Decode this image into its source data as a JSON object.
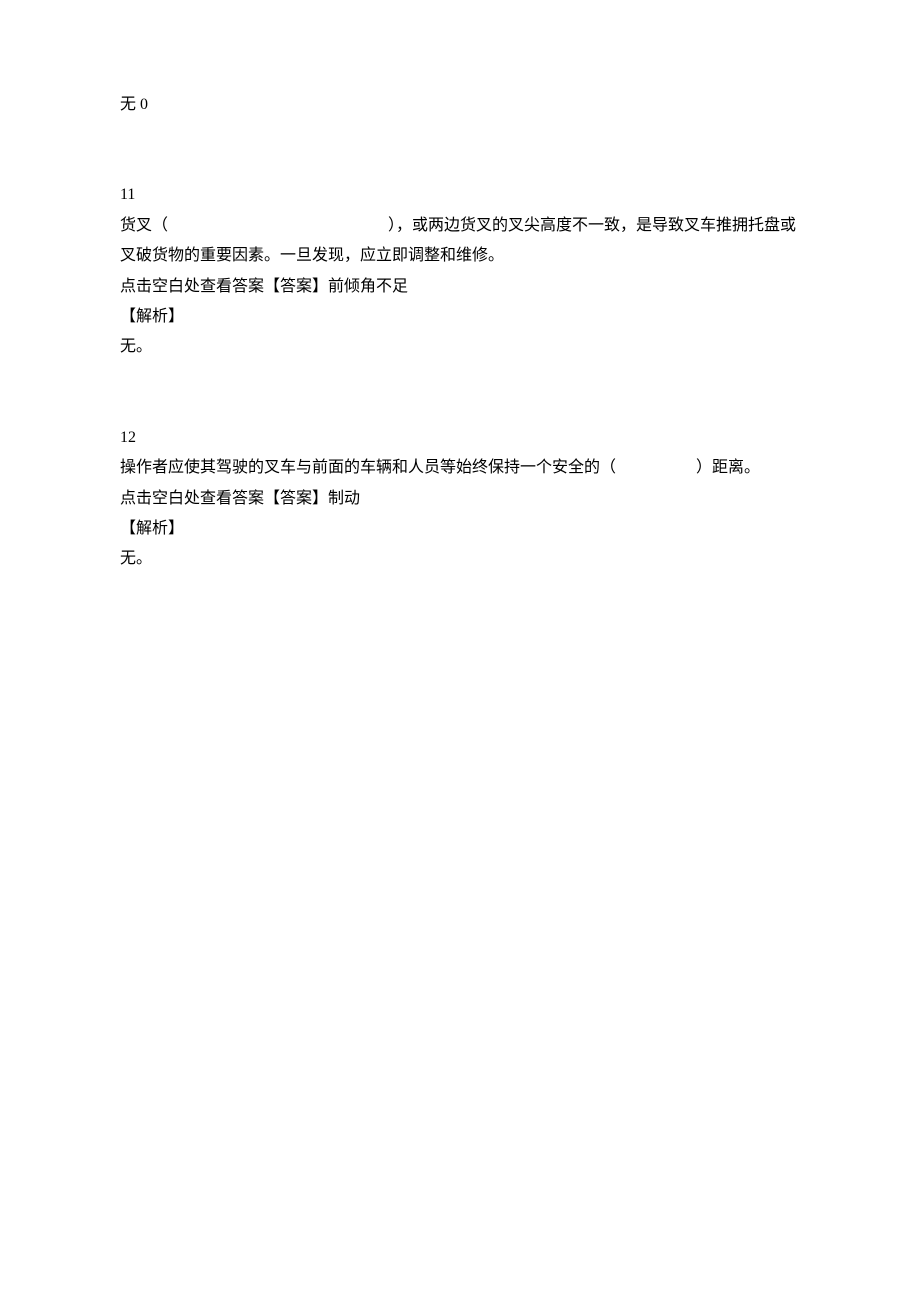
{
  "top_fragment": "无 0",
  "questions": [
    {
      "number": "11",
      "text_before": "货叉（",
      "text_after": "），或两边货叉的叉尖高度不一致，是导致叉车推拥托盘或叉破货物的重要因素。一旦发现，应立即调整和维修。",
      "answer_prefix": "点击空白处查看答案【答案】",
      "answer": "前倾角不足",
      "analysis_label": "【解析】",
      "analysis_text": "无。"
    },
    {
      "number": "12",
      "text_before": "操作者应使其驾驶的叉车与前面的车辆和人员等始终保持一个安全的（",
      "text_after": "）距离。",
      "answer_prefix": "点击空白处查看答案【答案】",
      "answer": "制动",
      "analysis_label": "【解析】",
      "analysis_text": "无。"
    }
  ]
}
